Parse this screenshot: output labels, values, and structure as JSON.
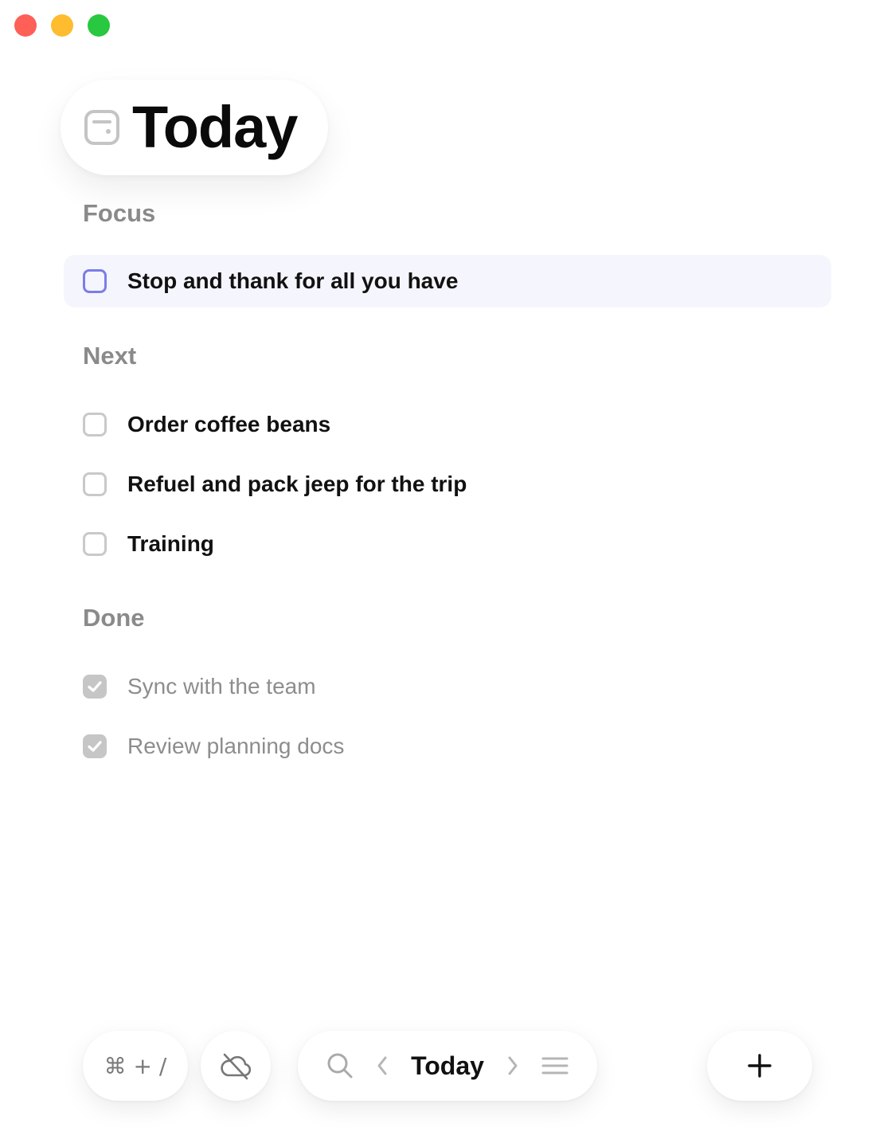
{
  "window": {
    "controls": [
      "close",
      "minimize",
      "zoom"
    ]
  },
  "header": {
    "title": "Today",
    "icon": "inbox-tray-icon"
  },
  "sections": {
    "focus": {
      "label": "Focus",
      "tasks": [
        {
          "text": "Stop and thank for all you have",
          "done": false
        }
      ]
    },
    "next": {
      "label": "Next",
      "tasks": [
        {
          "text": "Order coffee beans",
          "done": false
        },
        {
          "text": "Refuel and pack jeep for the trip",
          "done": false
        },
        {
          "text": "Training",
          "done": false
        }
      ]
    },
    "done": {
      "label": "Done",
      "tasks": [
        {
          "text": "Sync with the team",
          "done": true
        },
        {
          "text": "Review planning docs",
          "done": true
        }
      ]
    }
  },
  "toolbar": {
    "shortcut_label": "⌘ + /",
    "sync_icon": "cloud-off-icon",
    "search_icon": "search-icon",
    "prev_icon": "chevron-left-icon",
    "nav_title": "Today",
    "next_icon": "chevron-right-icon",
    "menu_icon": "menu-icon",
    "add_icon": "plus-icon"
  },
  "colors": {
    "close": "#fe5f57",
    "minimize": "#febc2e",
    "zoom": "#28c840",
    "focus_accent": "#7b7de8",
    "focus_background": "#f5f6fd"
  }
}
